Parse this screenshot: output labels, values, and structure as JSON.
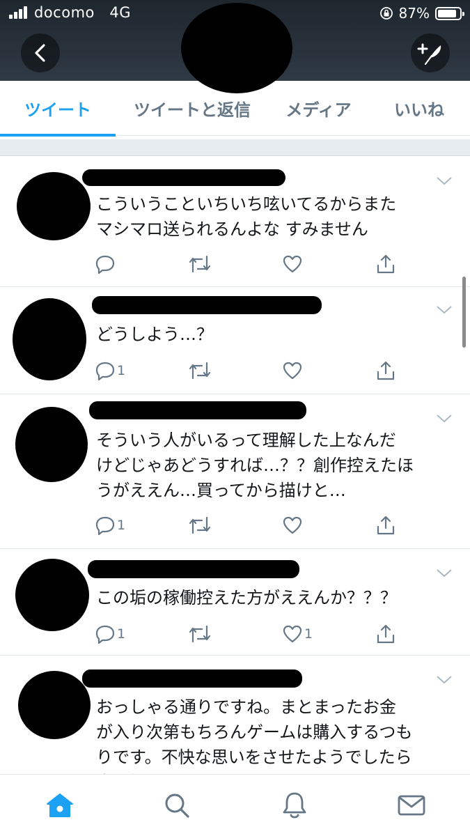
{
  "status_bar": {
    "carrier": "docomo",
    "network": "4G",
    "battery_percent": "87%",
    "battery_level": 0.87
  },
  "header": {
    "back_icon": "chevron-left-icon",
    "compose_icon": "compose-feather-icon"
  },
  "tabs": [
    {
      "label": "ツイート",
      "active": true
    },
    {
      "label": "ツイートと返信",
      "active": false
    },
    {
      "label": "メディア",
      "active": false
    },
    {
      "label": "いいね",
      "active": false
    }
  ],
  "tweets": [
    {
      "text": "こういうこといちいち呟いてるからまた\nマシマロ送られるんよな すみません",
      "reply_count": "",
      "like_count": ""
    },
    {
      "text": "どうしよう…？",
      "reply_count": "1",
      "like_count": ""
    },
    {
      "text": "そういう人がいるって理解した上なんだ\nけどじゃあどうすれば…？？創作控えたほ\nうがええん…買ってから描けと…",
      "reply_count": "1",
      "like_count": ""
    },
    {
      "text": "この垢の稼働控えた方がええんか？？？",
      "reply_count": "1",
      "like_count": "1"
    },
    {
      "text": "おっしゃる通りですね。まとまったお金\nが入り次第もちろんゲームは購入するつも\nりです。不快な思いをさせたようでしたら\n申し訳ありませんでした。",
      "reply_count": "",
      "like_count": ""
    }
  ],
  "bottom_nav": [
    {
      "icon": "home-icon",
      "active": true
    },
    {
      "icon": "search-icon",
      "active": false
    },
    {
      "icon": "notifications-bell-icon",
      "active": false
    },
    {
      "icon": "messages-envelope-icon",
      "active": false
    }
  ],
  "colors": {
    "accent": "#1da1f2",
    "icon_gray": "#657786",
    "header_dark": "#232b33"
  }
}
